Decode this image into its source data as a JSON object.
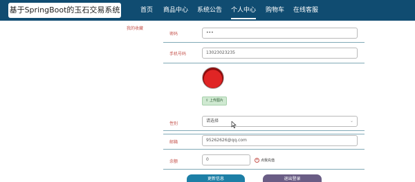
{
  "header": {
    "site_title": "基于SpringBoot的玉石交易系统",
    "nav": [
      "首页",
      "商品中心",
      "系统公告",
      "个人中心",
      "购物车",
      "在线客服"
    ]
  },
  "sidebar": {
    "favorites": "我的收藏"
  },
  "form": {
    "password_label": "密码",
    "password_value": "•••",
    "phone_label": "手机号码",
    "phone_value": "13023023235",
    "upload_label": "上传图片",
    "gender_label": "性别",
    "gender_value": "请选择",
    "email_label": "邮箱",
    "email_value": "95262626@qq.com",
    "balance_label": "余额",
    "balance_value": "0",
    "recharge_label": "点我充值",
    "update_button": "更新信息",
    "logout_button": "退出登录"
  },
  "colors": {
    "topbar": "#104c71",
    "label": "#c5534c",
    "update_button": "#1d7fa6",
    "logout_button": "#6a5d85"
  }
}
